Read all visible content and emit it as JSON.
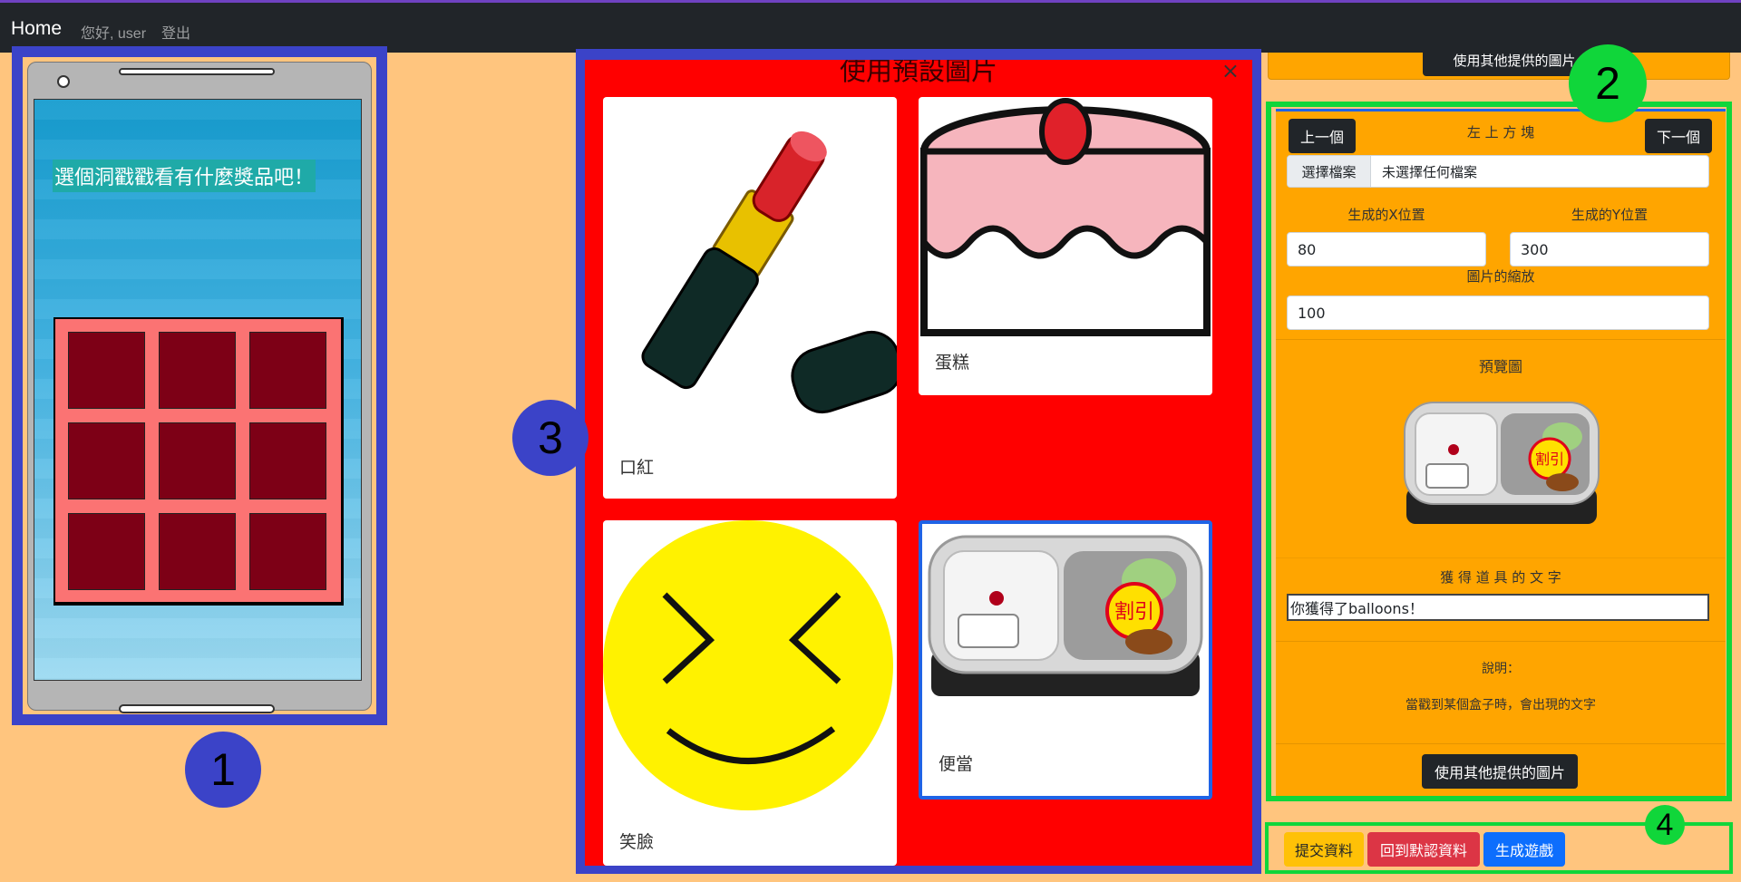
{
  "navbar": {
    "brand": "Home",
    "greeting": "您好, user",
    "logout": "登出"
  },
  "markers": [
    "1",
    "2",
    "3",
    "4"
  ],
  "phone": {
    "game_title": "選個洞戳戳看有什麼獎品吧！",
    "holes": 9
  },
  "modal": {
    "title": "使用預設圖片",
    "close": "×",
    "cards": [
      {
        "label": "口紅",
        "icon": "lipstick-image"
      },
      {
        "label": "蛋糕",
        "icon": "cake-image"
      },
      {
        "label": "笑臉",
        "icon": "smiley-face-image"
      },
      {
        "label": "便當",
        "icon": "bento-box-image",
        "selected": true
      }
    ]
  },
  "settings": {
    "top_button": "使用其他提供的圖片",
    "prev_button": "上一個",
    "next_button": "下一個",
    "block_name": "左 上 方 塊",
    "file_button": "選擇檔案",
    "file_status": "未選擇任何檔案",
    "x_label": "生成的X位置",
    "y_label": "生成的Y位置",
    "x_value": "80",
    "y_value": "300",
    "scale_label": "圖片的縮放",
    "scale_value": "100",
    "preview_label": "預覽圖",
    "text_label": "獲 得 道 具 的 文 字",
    "text_value": "你獲得了balloons！",
    "desc_title": "說明：",
    "desc_text": "當戳到某個盒子時，會出現的文字",
    "other_images_button": "使用其他提供的圖片"
  },
  "actions": {
    "submit": "提交資料",
    "reset": "回到默認資料",
    "generate": "生成遊戲"
  },
  "colors": {
    "page_bg": "#FFC57E",
    "navbar": "#212529",
    "panel": "#FFA500",
    "modal_bg": "#FF0000",
    "highlight_blue": "#3B43C8",
    "highlight_green": "#10D63A"
  }
}
